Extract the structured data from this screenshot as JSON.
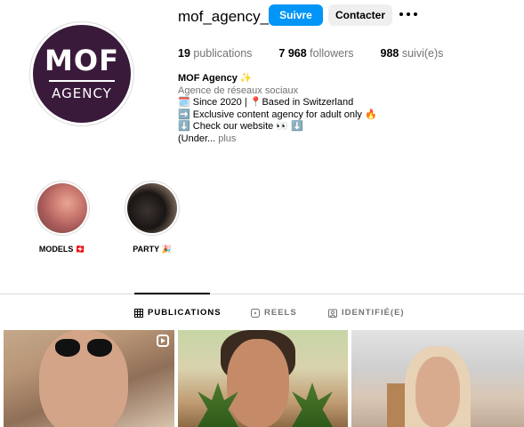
{
  "profile": {
    "avatar_top": "MOF",
    "avatar_bottom": "AGENCY",
    "username": "mof_agency_",
    "follow_label": "Suivre",
    "contact_label": "Contacter",
    "more_icon": "more-horizontal-icon"
  },
  "stats": {
    "posts_count": "19",
    "posts_label": "publications",
    "followers_count": "7 968",
    "followers_label": "followers",
    "following_count": "988",
    "following_label": "suivi(e)s"
  },
  "bio": {
    "name": "MOF Agency ✨",
    "category": "Agence de réseaux sociaux",
    "line1": "🗓️ Since 2020 | 📍Based in Switzerland",
    "line2": "➡️ Exclusive content agency for adult only 🔥",
    "line3": "⬇️ Check our website 👀 ⬇️",
    "line4": "(Under...",
    "more_label": "plus"
  },
  "highlights": [
    {
      "label": "MODELS 🇨🇭"
    },
    {
      "label": "PARTY 🎉"
    }
  ],
  "tabs": [
    {
      "label": "PUBLICATIONS",
      "icon": "grid-icon"
    },
    {
      "label": "REELS",
      "icon": "reels-icon"
    },
    {
      "label": "IDENTIFIÉ(E)",
      "icon": "tagged-icon"
    }
  ],
  "colors": {
    "primary_button": "#0095f6",
    "secondary_button": "#efefef",
    "avatar_bg": "#3a1a3b",
    "muted_text": "#737373"
  }
}
